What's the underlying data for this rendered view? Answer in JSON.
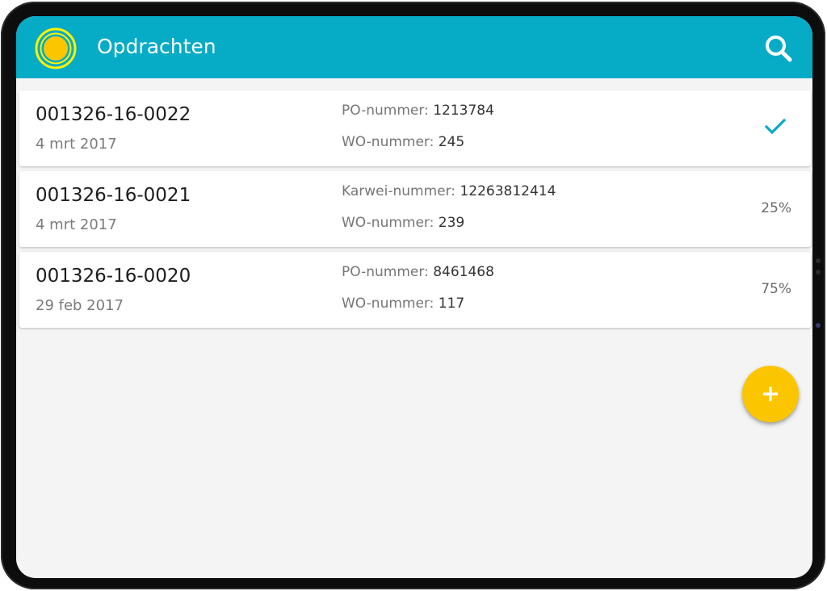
{
  "appbar": {
    "title": "Opdrachten",
    "logo_icon": "sun-logo-icon",
    "search_icon": "search-icon",
    "color": "#06abc6"
  },
  "orders": [
    {
      "id": "001326-16-0022",
      "date": "4 mrt 2017",
      "line1_label": "PO-nummer:",
      "line1_value": "1213784",
      "line2_label": "WO-nummer:",
      "line2_value": "245",
      "status": "",
      "status_icon": "checkmark-icon"
    },
    {
      "id": "001326-16-0021",
      "date": "4 mrt 2017",
      "line1_label": "Karwei-nummer:",
      "line1_value": "12263812414",
      "line2_label": "WO-nummer:",
      "line2_value": "239",
      "status": "25%"
    },
    {
      "id": "001326-16-0020",
      "date": "29 feb 2017",
      "line1_label": "PO-nummer:",
      "line1_value": "8461468",
      "line2_label": "WO-nummer:",
      "line2_value": "117",
      "status": "75%"
    }
  ],
  "fab": {
    "icon": "plus-icon",
    "color": "#fbc500"
  },
  "colors": {
    "accent": "#06abc6",
    "fab": "#fbc500",
    "logo_ring": "#fff200",
    "logo_center": "#fbc500"
  }
}
